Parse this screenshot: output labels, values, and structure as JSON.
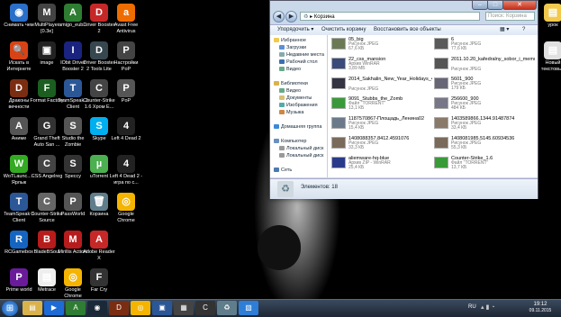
{
  "desktop": {
    "icons_col1": [
      {
        "label": "Снимать чем",
        "color": "#2a6fc9",
        "glyph": "◉"
      },
      {
        "label": "Искать в Интернете",
        "color": "#d84315",
        "glyph": "🔍"
      },
      {
        "label": "Драконы вечности",
        "color": "#7b2d12",
        "glyph": "D"
      },
      {
        "label": "Аниме",
        "color": "#555",
        "glyph": "A"
      },
      {
        "label": "WoTLaunc... - Ярлык",
        "color": "#3a2",
        "glyph": "W"
      },
      {
        "label": "TeamSpeak 3 Client",
        "color": "#2b5797",
        "glyph": "T"
      },
      {
        "label": "RCGamebox",
        "color": "#1565c0",
        "glyph": "R"
      },
      {
        "label": "Prime world",
        "color": "#6a1b9a",
        "glyph": "P"
      }
    ],
    "icons_col2": [
      {
        "label": "MultiPlayer [0.3e]",
        "color": "#444",
        "glyph": "M"
      },
      {
        "label": "image",
        "color": "#222",
        "glyph": "▣"
      },
      {
        "label": "Format Factory",
        "color": "#1b5e20",
        "glyph": "F"
      },
      {
        "label": "Grand Theft Auto San ...",
        "color": "#333",
        "glyph": "G"
      },
      {
        "label": "CSS Angelreg",
        "color": "#444",
        "glyph": "C"
      },
      {
        "label": "Counter-Strike Source",
        "color": "#666",
        "glyph": "C"
      },
      {
        "label": "BladeBSoul",
        "color": "#b71c1c",
        "glyph": "B"
      },
      {
        "label": "Metrace",
        "color": "#eee",
        "glyph": "▤"
      }
    ],
    "icons_col3": [
      {
        "label": "amigo_eub...",
        "color": "#2e7d32",
        "glyph": "A"
      },
      {
        "label": "IObit Driver Booster 2",
        "color": "#1a237e",
        "glyph": "I"
      },
      {
        "label": "TeamSpeak 3 Client",
        "color": "#2b5797",
        "glyph": "T"
      },
      {
        "label": "Studio the Zombie",
        "color": "#555",
        "glyph": "S"
      },
      {
        "label": "Speccy",
        "color": "#333",
        "glyph": "S"
      },
      {
        "label": "PassWorld",
        "color": "#555",
        "glyph": "P"
      },
      {
        "label": "Mirillis Action!",
        "color": "#b71c1c",
        "glyph": "M"
      },
      {
        "label": "Google Chrome",
        "color": "#f4b400",
        "glyph": "◎"
      }
    ],
    "icons_col4": [
      {
        "label": "Driver Booster 2",
        "color": "#c62828",
        "glyph": "D"
      },
      {
        "label": "Driver Booster 2 Tools Lite",
        "color": "#37474f",
        "glyph": "D"
      },
      {
        "label": "Counter-Strike 1.6 Хром E...",
        "color": "#444",
        "glyph": "C"
      },
      {
        "label": "Skype",
        "color": "#00aff0",
        "glyph": "S"
      },
      {
        "label": "uTorrent",
        "color": "#4caf50",
        "glyph": "µ"
      },
      {
        "label": "Корзина",
        "color": "#607d8b",
        "glyph": "🗑"
      },
      {
        "label": "Adobe Reader X",
        "color": "#c62828",
        "glyph": "A"
      },
      {
        "label": "Far Cry",
        "color": "#333",
        "glyph": "F"
      }
    ],
    "icons_col5": [
      {
        "label": "Avast Free Antivirus",
        "color": "#ef6c00",
        "glyph": "a"
      },
      {
        "label": "Настройки PoP",
        "color": "#444",
        "glyph": "P"
      },
      {
        "label": "PoP",
        "color": "#555",
        "glyph": "P"
      },
      {
        "label": "Left 4 Dead 2",
        "color": "#222",
        "glyph": "4"
      },
      {
        "label": "Left 4 Dead 2 - игра по с...",
        "color": "#222",
        "glyph": "4"
      },
      {
        "label": "Google Chrome",
        "color": "#f4b400",
        "glyph": "◎"
      }
    ],
    "icons_right": [
      {
        "label": "урок",
        "color": "#f2c94c",
        "glyph": "▤"
      },
      {
        "label": "Новый текстовый",
        "color": "#e0e0e0",
        "glyph": "▤"
      }
    ]
  },
  "window": {
    "address": "Корзина",
    "search_placeholder": "Поиск: Корзина",
    "toolbar": {
      "organize": "Упорядочить ▾",
      "empty_bin": "Очистить корзину",
      "restore_all": "Восстановить все объекты"
    },
    "nav": [
      {
        "label": "Избранное",
        "color": "#f2c94c",
        "indent": 0
      },
      {
        "label": "Загрузки",
        "color": "#5b8fd8",
        "indent": 1
      },
      {
        "label": "Недавние места",
        "color": "#8aa",
        "indent": 1
      },
      {
        "label": "Рабочий стол",
        "color": "#3a6fb0",
        "indent": 1
      },
      {
        "label": "Видео",
        "color": "#6a8",
        "indent": 1
      },
      {
        "label": "",
        "color": "",
        "indent": 0
      },
      {
        "label": "Библиотеки",
        "color": "#d9b24c",
        "indent": 0
      },
      {
        "label": "Видео",
        "color": "#6a8",
        "indent": 1
      },
      {
        "label": "Документы",
        "color": "#d9c070",
        "indent": 1
      },
      {
        "label": "Изображения",
        "color": "#5aa",
        "indent": 1
      },
      {
        "label": "Музыка",
        "color": "#c84",
        "indent": 1
      },
      {
        "label": "",
        "color": "",
        "indent": 0
      },
      {
        "label": "Домашняя группа",
        "color": "#3a8ad8",
        "indent": 0
      },
      {
        "label": "",
        "color": "",
        "indent": 0
      },
      {
        "label": "Компьютер",
        "color": "#6a90c0",
        "indent": 0
      },
      {
        "label": "Локальный диск",
        "color": "#999",
        "indent": 1
      },
      {
        "label": "Локальный диск",
        "color": "#999",
        "indent": 1
      },
      {
        "label": "",
        "color": "",
        "indent": 0
      },
      {
        "label": "Сеть",
        "color": "#4a7ab0",
        "indent": 0
      }
    ],
    "files_left": [
      {
        "name": "05_big",
        "type": "Рисунок JPEG",
        "size": "67,6 КБ",
        "thumb": "#6b7a55",
        "lines": 1
      },
      {
        "name": "22_css_mansion",
        "type": "Архив WinRAR",
        "size": "3,89 МБ",
        "thumb": "#3a4a7a",
        "lines": 1
      },
      {
        "name": "2014_Sakhalin_New_Year_Holidays_43",
        "type": "Рисунок JPEG",
        "size": "",
        "thumb": "#334",
        "lines": 2
      },
      {
        "name": "9091_Stubbs_the_Zomb",
        "type": "Файл \"TORRENT\"",
        "size": "13,1 КБ",
        "thumb": "#3a9a3a",
        "lines": 1
      },
      {
        "name": "1187570867-Площадь_Ленина02",
        "type": "Рисунок JPEG",
        "size": "15,4 КБ",
        "thumb": "#6a7a8a",
        "lines": 1
      },
      {
        "name": "1408088357.8412.4591076",
        "type": "Рисунок JPEG",
        "size": "33,3 КБ",
        "thumb": "#7a6a5a",
        "lines": 1
      },
      {
        "name": "aliemware-hq-blue",
        "type": "Архив ZIP - WinRAR",
        "size": "25,4 КБ",
        "thumb": "#2a3a8a",
        "lines": 1
      }
    ],
    "files_right": [
      {
        "name": "6",
        "type": "Рисунок JPEG",
        "size": "77,6 КБ",
        "thumb": "#5a5a5a",
        "lines": 1
      },
      {
        "name": "2011.10.20_kafedralny_sobor_i_memorial_kompleks_night",
        "type": "Рисунок JPEG",
        "size": "",
        "thumb": "#555",
        "lines": 2
      },
      {
        "name": "5601_900",
        "type": "Рисунок JPEG",
        "size": "179 КБ",
        "thumb": "#667",
        "lines": 1
      },
      {
        "name": "256600_900",
        "type": "Рисунок JPEG",
        "size": "484 КБ",
        "thumb": "#778",
        "lines": 1
      },
      {
        "name": "1403589866.1344.91487874",
        "type": "Рисунок JPEG",
        "size": "33,4 КБ",
        "thumb": "#8a7a6a",
        "lines": 1
      },
      {
        "name": "1408081985.5145.60934536",
        "type": "Рисунок JPEG",
        "size": "55,3 КБ",
        "thumb": "#7a6a5a",
        "lines": 1
      },
      {
        "name": "Counter-Strike_1.6",
        "type": "Файл \"TORRENT\"",
        "size": "13,7 КБ",
        "thumb": "#3a9a3a",
        "lines": 1
      }
    ],
    "status": "Элементов: 18"
  },
  "taskbar": {
    "start_glyph": "⊞",
    "items": [
      {
        "name": "explorer",
        "color": "#d9b24c",
        "glyph": "▤"
      },
      {
        "name": "media",
        "color": "#1e6bd6",
        "glyph": "▶"
      },
      {
        "name": "amigo",
        "color": "#2e7d32",
        "glyph": "A"
      },
      {
        "name": "steam",
        "color": "#1b2838",
        "glyph": "◉"
      },
      {
        "name": "game",
        "color": "#7b2d12",
        "glyph": "D"
      },
      {
        "name": "chrome",
        "color": "#f4b400",
        "glyph": "◎"
      },
      {
        "name": "app",
        "color": "#2b5797",
        "glyph": "▣"
      },
      {
        "name": "app2",
        "color": "#444",
        "glyph": "▦"
      },
      {
        "name": "cs",
        "color": "#333",
        "glyph": "C"
      },
      {
        "name": "recycle",
        "color": "#607d8b",
        "glyph": "♻"
      },
      {
        "name": "paint",
        "color": "#2e7dd6",
        "glyph": "▧"
      }
    ],
    "lang": "RU",
    "time": "19:12",
    "date": "09.11.2015"
  }
}
